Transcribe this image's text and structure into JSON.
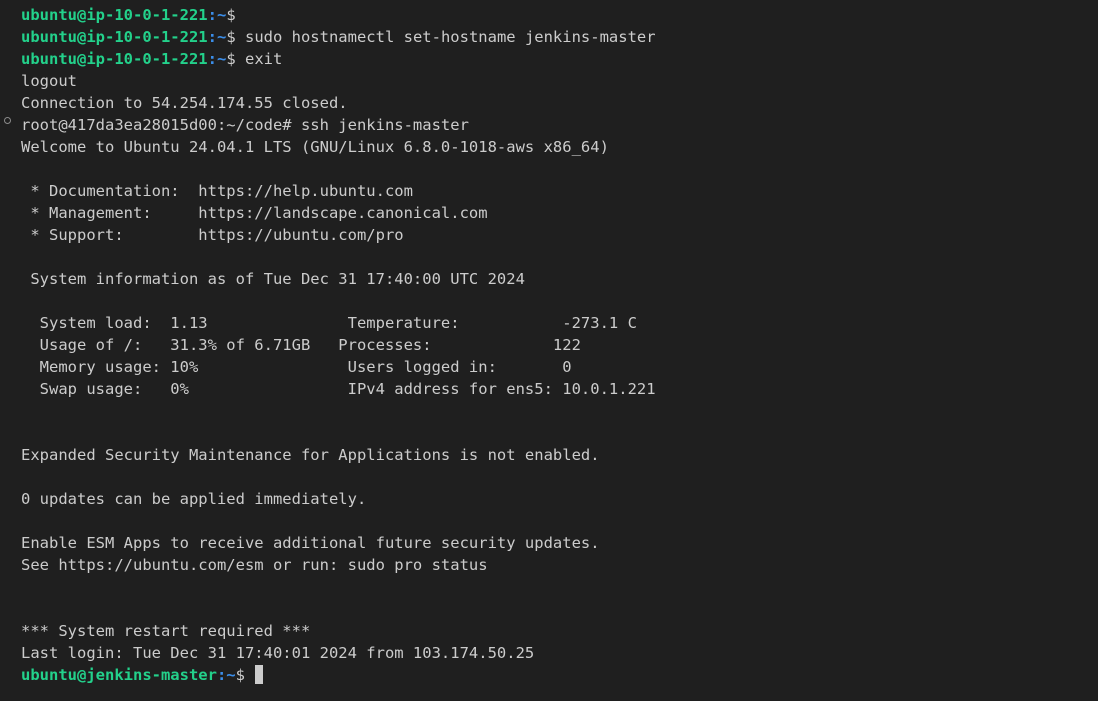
{
  "prompts": {
    "p1": {
      "user": "ubuntu@ip-10-0-1-221",
      "path": ":~",
      "sym": "$",
      "cmd": ""
    },
    "p2": {
      "user": "ubuntu@ip-10-0-1-221",
      "path": ":~",
      "sym": "$",
      "cmd": " sudo hostnamectl set-hostname jenkins-master"
    },
    "p3": {
      "user": "ubuntu@ip-10-0-1-221",
      "path": ":~",
      "sym": "$",
      "cmd": " exit"
    },
    "final": {
      "user": "ubuntu@jenkins-master",
      "path": ":~",
      "sym": "$ "
    }
  },
  "output": {
    "logout": "logout",
    "conn_closed": "Connection to 54.254.174.55 closed.",
    "root_cmd": "root@417da3ea28015d00:~/code# ssh jenkins-master",
    "welcome": "Welcome to Ubuntu 24.04.1 LTS (GNU/Linux 6.8.0-1018-aws x86_64)",
    "doc": " * Documentation:  https://help.ubuntu.com",
    "mgmt": " * Management:     https://landscape.canonical.com",
    "support": " * Support:        https://ubuntu.com/pro",
    "sysinfo": " System information as of Tue Dec 31 17:40:00 UTC 2024",
    "stat1": "  System load:  1.13               Temperature:           -273.1 C",
    "stat2": "  Usage of /:   31.3% of 6.71GB   Processes:             122",
    "stat3": "  Memory usage: 10%                Users logged in:       0",
    "stat4": "  Swap usage:   0%                 IPv4 address for ens5: 10.0.1.221",
    "esm": "Expanded Security Maintenance for Applications is not enabled.",
    "updates": "0 updates can be applied immediately.",
    "enable_esm": "Enable ESM Apps to receive additional future security updates.",
    "see_esm": "See https://ubuntu.com/esm or run: sudo pro status",
    "restart": "*** System restart required ***",
    "last_login": "Last login: Tue Dec 31 17:40:01 2024 from 103.174.50.25"
  },
  "colors": {
    "background": "#1f1f1f",
    "text": "#cccccc",
    "prompt_user": "#23d18b",
    "prompt_path": "#3b8eea"
  }
}
